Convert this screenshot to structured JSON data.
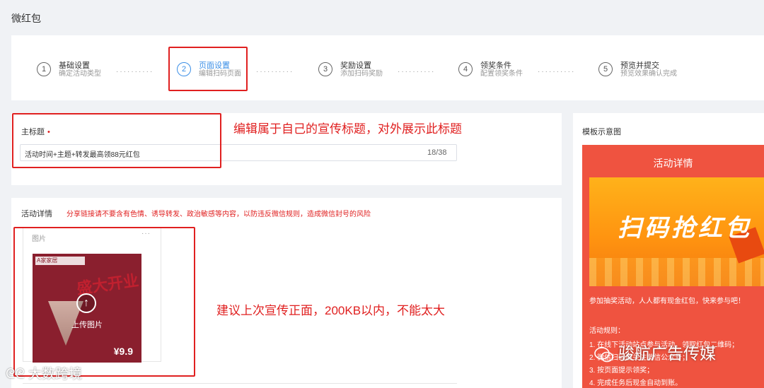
{
  "page": {
    "title": "微红包"
  },
  "steps": [
    {
      "num": "1",
      "name": "基础设置",
      "desc": "确定活动类型"
    },
    {
      "num": "2",
      "name": "页面设置",
      "desc": "编辑扫码页面"
    },
    {
      "num": "3",
      "name": "奖励设置",
      "desc": "添加扫码奖励"
    },
    {
      "num": "4",
      "name": "领奖条件",
      "desc": "配置领奖条件"
    },
    {
      "num": "5",
      "name": "预览并提交",
      "desc": "预览效果确认完成"
    }
  ],
  "active_step": 2,
  "title_section": {
    "label": "主标题",
    "required_mark": "•",
    "value": "活动时间+主题+转发最高领88元红包",
    "count": "18/38"
  },
  "annotations": {
    "title_note": "编辑属于自己的宣传标题，对外展示此标题",
    "image_note": "建议上次宣传正面，200KB以内，不能太大"
  },
  "detail_section": {
    "label": "活动详情",
    "warning": "分享链接请不要含有色情、诱导转发、政治敏感等内容，以防违反微信规则，造成微信封号的风险",
    "image_label": "图片",
    "more": "···",
    "upload_label": "上传图片",
    "poster": {
      "header": "A家家居",
      "headline": "盛大开业",
      "price": "¥9.9"
    }
  },
  "preview": {
    "label": "模板示意图",
    "phone_title": "活动详情",
    "banner_text": "扫码抢红包",
    "intro": "参加抽奖活动，人人都有现金红包，快来参与吧！",
    "rules_title": "活动规则：",
    "rules": [
      "1. 在线下活动站点参与活动，领取红包二维码；",
      "2. 微信扫码后关注微信公众号；",
      "3. 按页面提示领奖；",
      "4. 完成任务后现金自动到账。"
    ]
  },
  "watermarks": {
    "right": "骏航广告传媒",
    "left": "大数跨境"
  },
  "colors": {
    "accent": "#3a8ee6",
    "annotation": "#e02020",
    "preview_bg": "#ef5340"
  }
}
